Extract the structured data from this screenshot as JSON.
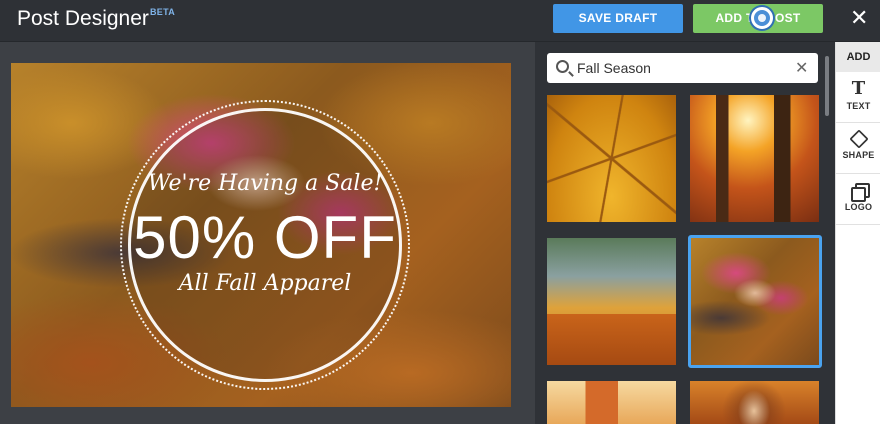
{
  "header": {
    "title": "Post Designer",
    "badge": "BETA",
    "save_draft_label": "SAVE DRAFT",
    "add_post_label": "ADD TO POST",
    "close_icon": "close-icon"
  },
  "canvas": {
    "line1": "We're Having a Sale!",
    "line2": "50% OFF",
    "line3": "All Fall Apparel"
  },
  "search": {
    "value": "Fall Season",
    "placeholder": "Search"
  },
  "images": [
    {
      "name": "leaf-closeup",
      "selected": false
    },
    {
      "name": "autumn-forest-sunlight",
      "selected": false
    },
    {
      "name": "park-bench-leaves",
      "selected": false
    },
    {
      "name": "woman-in-leaves",
      "selected": true
    },
    {
      "name": "suitcase-autumn",
      "selected": false
    },
    {
      "name": "woman-portrait-autumn",
      "selected": false
    }
  ],
  "sidebar": {
    "heading": "ADD",
    "items": [
      {
        "label": "TEXT",
        "icon": "text-icon"
      },
      {
        "label": "SHAPE",
        "icon": "shape-icon"
      },
      {
        "label": "LOGO",
        "icon": "logo-icon"
      }
    ]
  },
  "colors": {
    "save_draft": "#4196e6",
    "add_post": "#7cc865",
    "selected_border": "#4aa3f0"
  }
}
